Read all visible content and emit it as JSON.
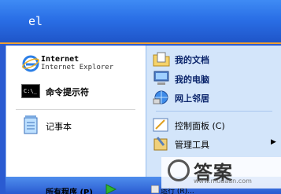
{
  "header": {
    "username": "el"
  },
  "pinned": [
    {
      "name": "internet",
      "title": "Internet",
      "subtitle": "Internet Explorer",
      "icon": "internet-explorer-icon"
    },
    {
      "name": "cmd",
      "label": "命令提示符",
      "icon": "command-prompt-icon"
    }
  ],
  "recent": [
    {
      "name": "notepad",
      "label": "记事本",
      "icon": "notepad-icon"
    }
  ],
  "all_programs": {
    "label": "所有程序 (P)",
    "icon": "green-arrow-icon"
  },
  "right": [
    {
      "name": "my-documents",
      "label": "我的文档",
      "icon": "folder-documents-icon"
    },
    {
      "name": "my-computer",
      "label": "我的电脑",
      "icon": "computer-icon"
    },
    {
      "name": "network-places",
      "label": "网上邻居",
      "icon": "network-icon"
    },
    {
      "name": "control-panel",
      "label": "控制面板 (C)",
      "icon": "control-panel-icon"
    },
    {
      "name": "admin-tools",
      "label": "管理工具",
      "icon": "admin-tools-icon"
    },
    {
      "name": "run",
      "label": "运行 (R)...",
      "icon": "run-icon"
    }
  ],
  "watermark": {
    "text": "答案",
    "url": "www.mudaan.com"
  },
  "colors": {
    "header": "#2a6fe6",
    "right_pane": "#d3e5fa",
    "accent": "#f0a030"
  }
}
